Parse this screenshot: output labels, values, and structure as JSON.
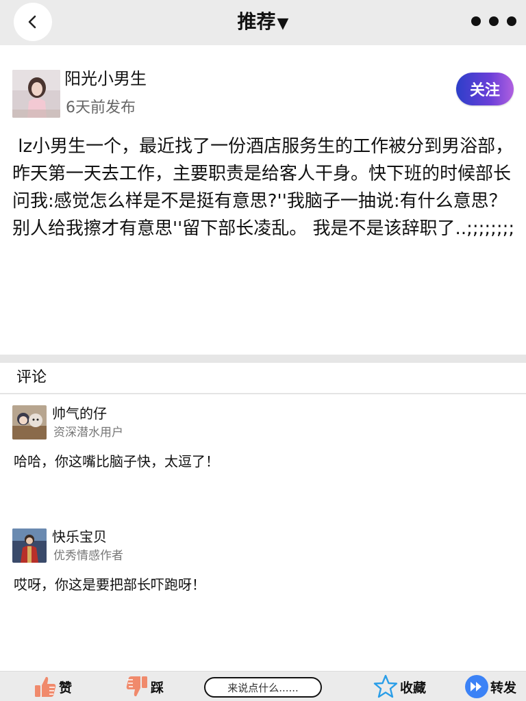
{
  "header": {
    "title": "推荐",
    "title_caret": "▼"
  },
  "post": {
    "author": "阳光小男生",
    "time": "6天前发布",
    "follow_label": "关注",
    "content": " lz小男生一个，最近找了一份酒店服务生的工作被分到男浴部，昨天第一天去工作，主要职责是给客人干身。快下班的时候部长问我:感觉怎么样是不是挺有意思?''我脑子一抽说:有什么意思？别人给我擦才有意思''留下部长凌乱。 我是不是该辞职了..;;;;;;;;"
  },
  "comments": {
    "title": "评论",
    "items": [
      {
        "name": "帅气的仔",
        "tag": "资深潜水用户",
        "text": "哈哈，你这嘴比脑子快，太逗了！"
      },
      {
        "name": "快乐宝贝",
        "tag": "优秀情感作者",
        "text": "哎呀，你这是要把部长吓跑呀！"
      }
    ]
  },
  "bottombar": {
    "like_label": "赞",
    "dislike_label": "踩",
    "input_placeholder": "来说点什么......",
    "favorite_label": "收藏",
    "share_label": "转发"
  },
  "colors": {
    "follow_gradient_start": "#2d3fc9",
    "follow_gradient_end": "#b060e0",
    "thumb_icon": "#f08a6c",
    "star_icon": "#2a9ee8",
    "share_icon": "#3b82f6"
  }
}
